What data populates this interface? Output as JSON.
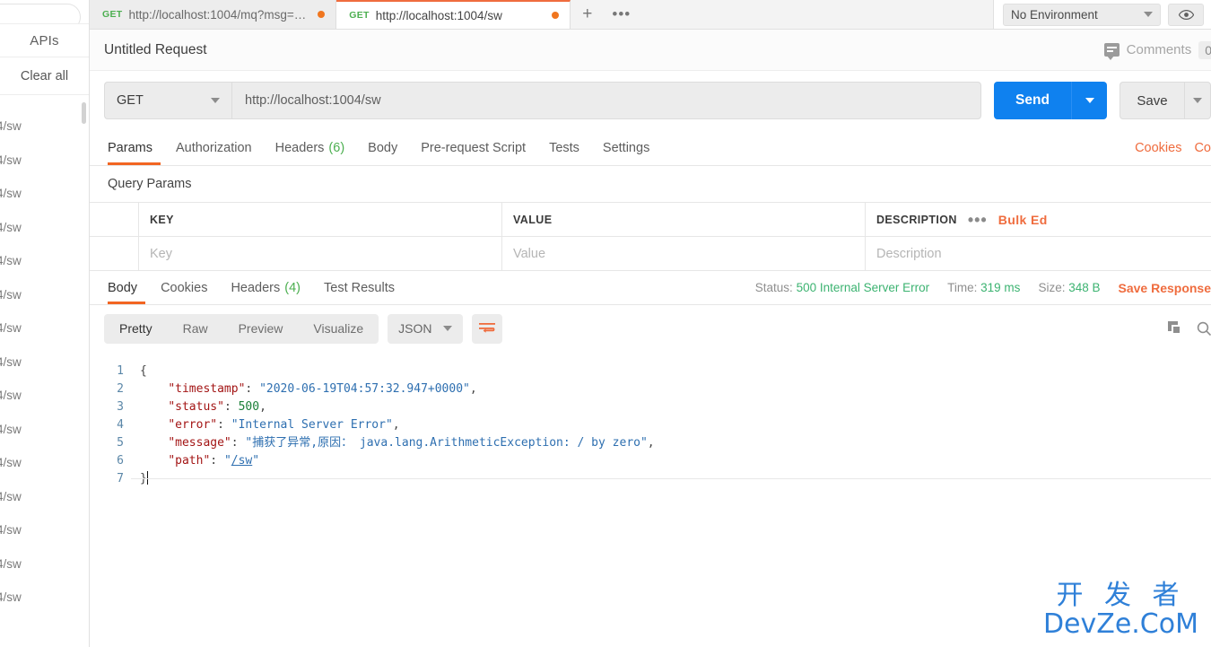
{
  "sidebar": {
    "apis_label": "APIs",
    "clear_all_label": "Clear all",
    "history_items": [
      "4/sw",
      "4/sw",
      "4/sw",
      "4/sw",
      "4/sw",
      "4/sw",
      "4/sw",
      "4/sw",
      "4/sw",
      "4/sw",
      "4/sw",
      "4/sw",
      "4/sw",
      "4/sw",
      "4/sw"
    ]
  },
  "tabs": [
    {
      "method": "GET",
      "url": "http://localhost:1004/mq?msg=…",
      "active": false
    },
    {
      "method": "GET",
      "url": "http://localhost:1004/sw",
      "active": true
    }
  ],
  "tabbar": {
    "new_tab_label": "+",
    "more_label": "•••",
    "environment": "No Environment",
    "eye_icon": "eye-icon"
  },
  "request": {
    "title": "Untitled Request",
    "comments_label": "Comments",
    "comments_count": "0",
    "method": "GET",
    "url": "http://localhost:1004/sw",
    "send_label": "Send",
    "save_label": "Save",
    "tabs": [
      {
        "label": "Params",
        "count": "",
        "active": true
      },
      {
        "label": "Authorization",
        "count": "",
        "active": false
      },
      {
        "label": "Headers",
        "count": "(6)",
        "active": false
      },
      {
        "label": "Body",
        "count": "",
        "active": false
      },
      {
        "label": "Pre-request Script",
        "count": "",
        "active": false
      },
      {
        "label": "Tests",
        "count": "",
        "active": false
      },
      {
        "label": "Settings",
        "count": "",
        "active": false
      }
    ],
    "cookies_link": "Cookies",
    "code_link": "Co"
  },
  "query_params": {
    "section_title": "Query Params",
    "headers": [
      "KEY",
      "VALUE",
      "DESCRIPTION"
    ],
    "placeholder_row": [
      "Key",
      "Value",
      "Description"
    ],
    "bulk_edit_label": "Bulk Ed",
    "more_label": "•••"
  },
  "response": {
    "tabs": [
      {
        "label": "Body",
        "count": "",
        "active": true
      },
      {
        "label": "Cookies",
        "count": "",
        "active": false
      },
      {
        "label": "Headers",
        "count": "(4)",
        "active": false
      },
      {
        "label": "Test Results",
        "count": "",
        "active": false
      }
    ],
    "status_label": "Status:",
    "status_value": "500 Internal Server Error",
    "time_label": "Time:",
    "time_value": "319 ms",
    "size_label": "Size:",
    "size_value": "348 B",
    "save_response_label": "Save Response",
    "view_modes": [
      {
        "label": "Pretty",
        "active": true
      },
      {
        "label": "Raw",
        "active": false
      },
      {
        "label": "Preview",
        "active": false
      },
      {
        "label": "Visualize",
        "active": false
      }
    ],
    "format": "JSON",
    "line_numbers": [
      "1",
      "2",
      "3",
      "4",
      "5",
      "6",
      "7"
    ],
    "body_lines": [
      {
        "segments": [
          {
            "t": "{",
            "c": "p"
          }
        ]
      },
      {
        "segments": [
          {
            "t": "    ",
            "c": "p"
          },
          {
            "t": "\"timestamp\"",
            "c": "k"
          },
          {
            "t": ": ",
            "c": "p"
          },
          {
            "t": "\"2020-06-19T04:57:32.947+0000\"",
            "c": "s"
          },
          {
            "t": ",",
            "c": "p"
          }
        ]
      },
      {
        "segments": [
          {
            "t": "    ",
            "c": "p"
          },
          {
            "t": "\"status\"",
            "c": "k"
          },
          {
            "t": ": ",
            "c": "p"
          },
          {
            "t": "500",
            "c": "n"
          },
          {
            "t": ",",
            "c": "p"
          }
        ]
      },
      {
        "segments": [
          {
            "t": "    ",
            "c": "p"
          },
          {
            "t": "\"error\"",
            "c": "k"
          },
          {
            "t": ": ",
            "c": "p"
          },
          {
            "t": "\"Internal Server Error\"",
            "c": "s"
          },
          {
            "t": ",",
            "c": "p"
          }
        ]
      },
      {
        "segments": [
          {
            "t": "    ",
            "c": "p"
          },
          {
            "t": "\"message\"",
            "c": "k"
          },
          {
            "t": ": ",
            "c": "p"
          },
          {
            "t": "\"捕获了异常,原因： java.lang.ArithmeticException: / by zero\"",
            "c": "s"
          },
          {
            "t": ",",
            "c": "p"
          }
        ]
      },
      {
        "segments": [
          {
            "t": "    ",
            "c": "p"
          },
          {
            "t": "\"path\"",
            "c": "k"
          },
          {
            "t": ": ",
            "c": "p"
          },
          {
            "t": "\"",
            "c": "s"
          },
          {
            "t": "/sw",
            "c": "link"
          },
          {
            "t": "\"",
            "c": "s"
          }
        ]
      },
      {
        "segments": [
          {
            "t": "}",
            "c": "p"
          }
        ]
      }
    ],
    "copy_icon": "copy-icon",
    "search_icon": "search-icon"
  },
  "watermark": {
    "line1": "开 发 者",
    "line2": "DevZe.CoM"
  },
  "colors": {
    "accent_orange": "#ef6c3e",
    "send_blue": "#0f81ef",
    "success_green": "#4caf50",
    "watermark_blue": "#2f80d8"
  }
}
